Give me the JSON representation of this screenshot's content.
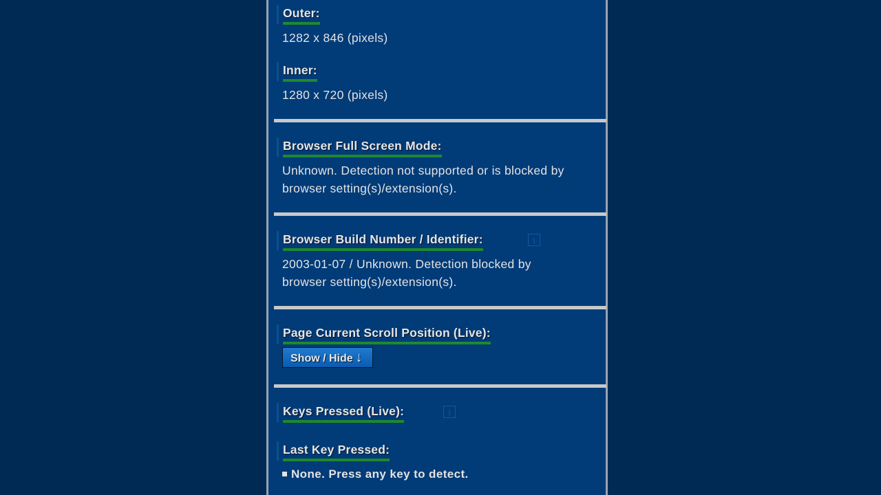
{
  "sections": {
    "outer": {
      "label": "Outer:",
      "value": "1282 x 846 (pixels)"
    },
    "inner": {
      "label": "Inner:",
      "value": "1280 x 720 (pixels)"
    },
    "fullscreen": {
      "label": "Browser Full Screen Mode:",
      "value_line1": "Unknown. Detection not supported or is blocked by",
      "value_line2": "browser setting(s)/extension(s)."
    },
    "build": {
      "label": "Browser Build Number / Identifier:",
      "info_icon": "i",
      "value_line1": "2003-01-07 / Unknown. Detection blocked by",
      "value_line2": "browser setting(s)/extension(s)."
    },
    "scroll": {
      "label": "Page Current Scroll Position (Live):",
      "button_label": "Show / Hide",
      "button_arrow": "↓"
    },
    "keys": {
      "label": "Keys Pressed (Live):",
      "info_icon": "i"
    },
    "last_key": {
      "label": "Last Key Pressed:",
      "value": "None. Press any key to detect."
    }
  },
  "colors": {
    "page_bg": "#002a54",
    "panel_bg": "#013b78",
    "underline": "#1e8a2c",
    "separator": "#c9c9c9"
  }
}
